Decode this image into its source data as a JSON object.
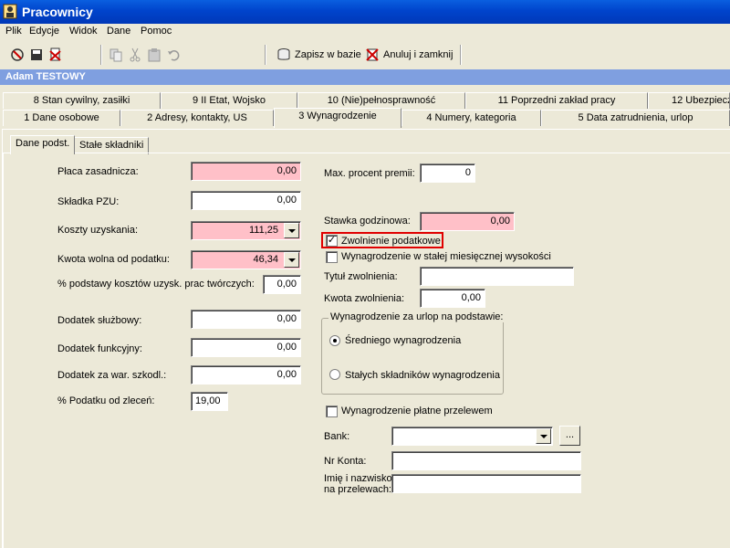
{
  "window": {
    "title": "Pracownicy"
  },
  "menu": [
    "Plik",
    "Edycje",
    "Widok",
    "Dane",
    "Pomoc"
  ],
  "toolbar": {
    "save_label": "Zapisz w bazie",
    "cancel_label": "Anuluj i zamknij"
  },
  "employee": {
    "name": "Adam TESTOWY"
  },
  "tabs_row1": [
    "8 Stan cywilny, zasiłki",
    "9 II Etat, Wojsko",
    "10 (Nie)pełnosprawność",
    "11 Poprzedni zakład pracy",
    "12 Ubezpiecz"
  ],
  "tabs_row2": [
    "1 Dane osobowe",
    "2 Adresy, kontakty, US",
    "3 Wynagrodzenie",
    "4 Numery, kategoria",
    "5 Data zatrudnienia, urlop"
  ],
  "subtabs": [
    "Dane podst.",
    "Stałe składniki"
  ],
  "left": {
    "placa_label": "Płaca zasadnicza:",
    "placa_value": "0,00",
    "pzu_label": "Składka PZU:",
    "pzu_value": "0,00",
    "koszty_label": "Koszty uzyskania:",
    "koszty_value": "111,25",
    "kwota_label": "Kwota wolna od podatku:",
    "kwota_value": "46,34",
    "procent_label": "% podstawy kosztów uzysk. prac twórczych:",
    "procent_value": "0,00",
    "sluzbowy_label": "Dodatek służbowy:",
    "sluzbowy_value": "0,00",
    "funkcyjny_label": "Dodatek funkcyjny:",
    "funkcyjny_value": "0,00",
    "szkodl_label": "Dodatek za war. szkodl.:",
    "szkodl_value": "0,00",
    "zlecen_label": "% Podatku od zleceń:",
    "zlecen_value": "19,00"
  },
  "right": {
    "maxpremii_label": "Max. procent premii:",
    "maxpremii_value": "0",
    "stawka_label": "Stawka godzinowa:",
    "stawka_value": "0,00",
    "zwolnienie_label": "Zwolnienie podatkowe",
    "stala_label": "Wynagrodzenie w stałej miesięcznej wysokości",
    "tytul_label": "Tytuł zwolnienia:",
    "tytul_value": "",
    "kwotazw_label": "Kwota zwolnienia:",
    "kwotazw_value": "0,00",
    "urlop_group": "Wynagrodzenie za urlop na podstawie:",
    "radio1": "Średniego wynagrodzenia",
    "radio2": "Stałych składników wynagrodzenia",
    "przelew_label": "Wynagrodzenie płatne przelewem",
    "bank_label": "Bank:",
    "bank_value": "",
    "bank_button": "...",
    "konto_label": "Nr Konta:",
    "konto_value": "",
    "imie_label1": "Imię i nazwisko",
    "imie_label2": "na przelewach:",
    "imie_value": ""
  }
}
